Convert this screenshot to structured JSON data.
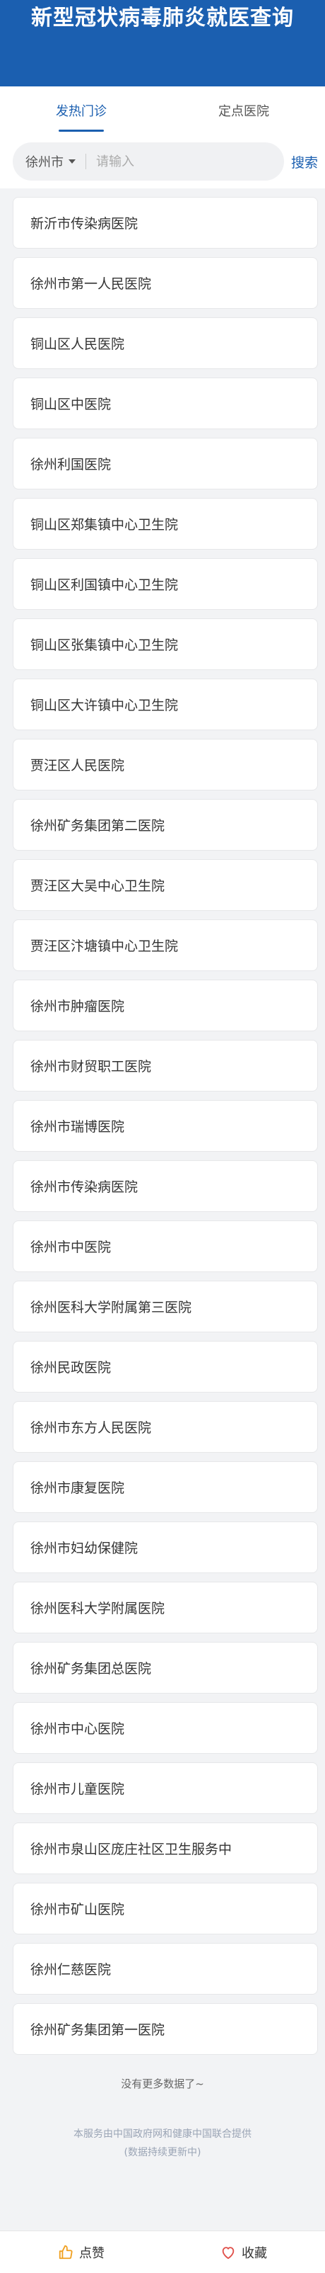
{
  "header": {
    "title": "新型冠状病毒肺炎就医查询"
  },
  "tabs": [
    {
      "label": "发热门诊",
      "active": true
    },
    {
      "label": "定点医院",
      "active": false
    }
  ],
  "search": {
    "city": "徐州市",
    "placeholder": "请输入",
    "value": "",
    "button": "搜索"
  },
  "hospitals": [
    "新沂市传染病医院",
    "徐州市第一人民医院",
    "铜山区人民医院",
    "铜山区中医院",
    "徐州利国医院",
    "铜山区郑集镇中心卫生院",
    "铜山区利国镇中心卫生院",
    "铜山区张集镇中心卫生院",
    "铜山区大许镇中心卫生院",
    "贾汪区人民医院",
    "徐州矿务集团第二医院",
    "贾汪区大吴中心卫生院",
    "贾汪区汴塘镇中心卫生院",
    "徐州市肿瘤医院",
    "徐州市财贸职工医院",
    "徐州市瑞博医院",
    "徐州市传染病医院",
    "徐州市中医院",
    "徐州医科大学附属第三医院",
    "徐州民政医院",
    "徐州市东方人民医院",
    "徐州市康复医院",
    "徐州市妇幼保健院",
    "徐州医科大学附属医院",
    "徐州矿务集团总医院",
    "徐州市中心医院",
    "徐州市儿童医院",
    "徐州市泉山区庞庄社区卫生服务中",
    "徐州市矿山医院",
    "徐州仁慈医院",
    "徐州矿务集团第一医院"
  ],
  "list_end": "没有更多数据了~",
  "footer": {
    "line1": "本服务由中国政府网和健康中国联合提供",
    "line2": "(数据持续更新中)"
  },
  "bottom_bar": {
    "like": "点赞",
    "collect": "收藏"
  },
  "colors": {
    "primary": "#1b5fb0",
    "like_icon": "#f0a020",
    "collect_icon": "#e0504a"
  }
}
